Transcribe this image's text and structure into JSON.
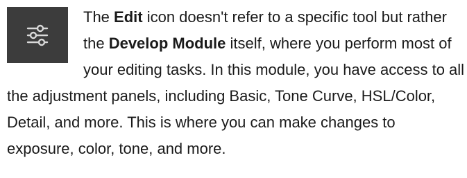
{
  "icon": {
    "name": "sliders-icon",
    "background": "#3c3c3c",
    "stroke": "#d9d9d9"
  },
  "paragraph": {
    "part1": "The ",
    "bold1": "Edit",
    "part2": " icon doesn't refer to a specific tool but rather the ",
    "bold2": "Develop Module",
    "part3": " itself, where you perform most of your editing tasks. In this module, you have access to all the adjustment panels, including Basic, Tone Curve, HSL/Color, Detail, and more. This is where you can make changes to exposure, color, tone, and more."
  }
}
